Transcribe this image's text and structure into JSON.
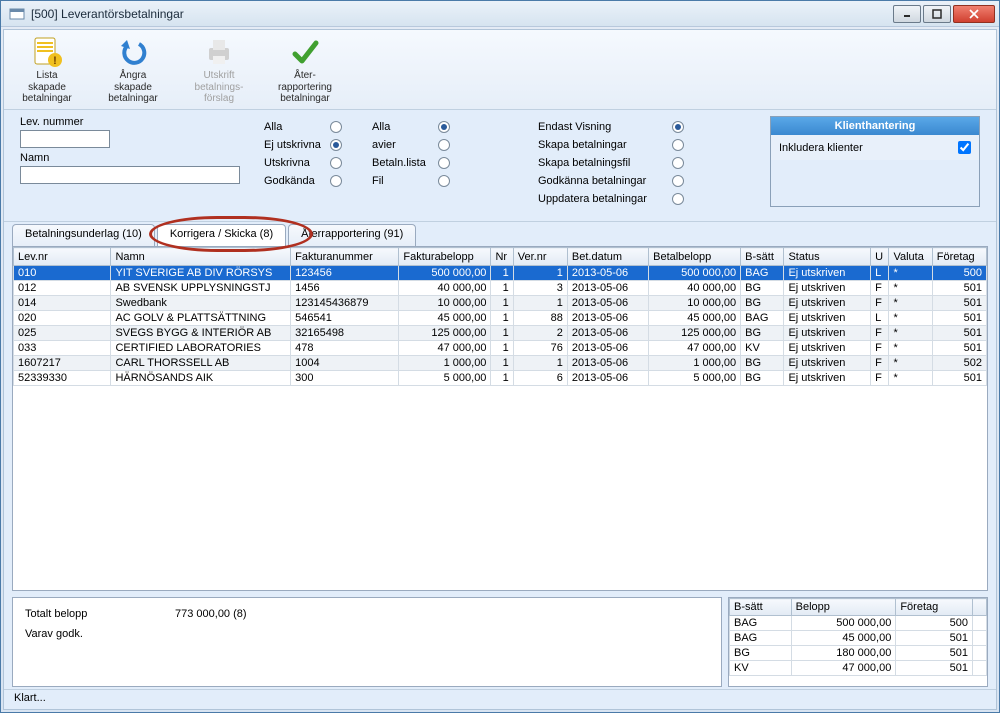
{
  "window": {
    "title": "[500]  Leverantörsbetalningar"
  },
  "toolbar": [
    {
      "name": "lista-skapade",
      "label": "Lista\nskapade\nbetalningar",
      "enabled": true,
      "color": "#f0c020"
    },
    {
      "name": "angra-skapade",
      "label": "Ångra\nskapade\nbetalningar",
      "enabled": true,
      "color": "#3080d0"
    },
    {
      "name": "utskrift",
      "label": "Utskrift\nbetalnings-\nförslag",
      "enabled": false,
      "color": "#c0c0c0"
    },
    {
      "name": "aterrapp",
      "label": "Åter-\nrapportering\nbetalningar",
      "enabled": true,
      "color": "#40a030"
    }
  ],
  "filters": {
    "levnummer_label": "Lev. nummer",
    "levnummer_value": "",
    "namn_label": "Namn",
    "namn_value": "",
    "col1": [
      {
        "label": "Alla",
        "selected": false
      },
      {
        "label": "Ej utskrivna",
        "selected": true
      },
      {
        "label": "Utskrivna",
        "selected": false
      },
      {
        "label": "Godkända",
        "selected": false
      }
    ],
    "col2": [
      {
        "label": "Alla",
        "selected": true
      },
      {
        "label": "avier",
        "selected": false
      },
      {
        "label": "Betaln.lista",
        "selected": false
      },
      {
        "label": "Fil",
        "selected": false
      }
    ],
    "opts": [
      {
        "label": "Endast Visning",
        "selected": true
      },
      {
        "label": "Skapa betalningar",
        "selected": false
      },
      {
        "label": "Skapa betalningsfil",
        "selected": false
      },
      {
        "label": "Godkänna betalningar",
        "selected": false
      },
      {
        "label": "Uppdatera betalningar",
        "selected": false
      }
    ]
  },
  "klient": {
    "header": "Klienthantering",
    "label": "Inkludera klienter",
    "checked": true
  },
  "tabs": [
    {
      "name": "betalningsunderlag",
      "label": "Betalningsunderlag (10)",
      "active": false
    },
    {
      "name": "korrigera-skicka",
      "label": "Korrigera / Skicka (8)",
      "active": true
    },
    {
      "name": "aterrapportering",
      "label": "Återrapportering (91)",
      "active": false
    }
  ],
  "grid": {
    "headers": [
      "Lev.nr",
      "Namn",
      "Fakturanummer",
      "Fakturabelopp",
      "Nr",
      "Ver.nr",
      "Bet.datum",
      "Betalbelopp",
      "B-sätt",
      "Status",
      "U",
      "Valuta",
      "Företag"
    ],
    "rows": [
      {
        "sel": true,
        "alt": false,
        "cells": [
          "010",
          "YIT SVERIGE AB DIV RÖRSYS",
          "123456",
          "500 000,00",
          "1",
          "1",
          "2013-05-06",
          "500 000,00",
          "BAG",
          "Ej utskriven",
          "L",
          "*",
          "500"
        ]
      },
      {
        "sel": false,
        "alt": false,
        "cells": [
          "012",
          "AB SVENSK UPPLYSNINGSTJ",
          "1456",
          "40 000,00",
          "1",
          "3",
          "2013-05-06",
          "40 000,00",
          "BG",
          "Ej utskriven",
          "F",
          "*",
          "501"
        ]
      },
      {
        "sel": false,
        "alt": true,
        "cells": [
          "014",
          "Swedbank",
          "123145436879",
          "10 000,00",
          "1",
          "1",
          "2013-05-06",
          "10 000,00",
          "BG",
          "Ej utskriven",
          "F",
          "*",
          "501"
        ]
      },
      {
        "sel": false,
        "alt": false,
        "cells": [
          "020",
          "AC GOLV & PLATTSÄTTNING",
          "546541",
          "45 000,00",
          "1",
          "88",
          "2013-05-06",
          "45 000,00",
          "BAG",
          "Ej utskriven",
          "L",
          "*",
          "501"
        ]
      },
      {
        "sel": false,
        "alt": true,
        "cells": [
          "025",
          "SVEGS BYGG & INTERIÖR AB",
          "32165498",
          "125 000,00",
          "1",
          "2",
          "2013-05-06",
          "125 000,00",
          "BG",
          "Ej utskriven",
          "F",
          "*",
          "501"
        ]
      },
      {
        "sel": false,
        "alt": false,
        "cells": [
          "033",
          "CERTIFIED LABORATORIES",
          "478",
          "47 000,00",
          "1",
          "76",
          "2013-05-06",
          "47 000,00",
          "KV",
          "Ej utskriven",
          "F",
          "*",
          "501"
        ]
      },
      {
        "sel": false,
        "alt": true,
        "cells": [
          "1607217",
          "CARL THORSSELL AB",
          "1004",
          "1 000,00",
          "1",
          "1",
          "2013-05-06",
          "1 000,00",
          "BG",
          "Ej utskriven",
          "F",
          "*",
          "502"
        ]
      },
      {
        "sel": false,
        "alt": false,
        "cells": [
          "52339330",
          "HÄRNÖSANDS AIK",
          "300",
          "5 000,00",
          "1",
          "6",
          "2013-05-06",
          "5 000,00",
          "BG",
          "Ej utskriven",
          "F",
          "*",
          "501"
        ]
      }
    ]
  },
  "summary": {
    "total_label": "Totalt belopp",
    "total_value": "773 000,00 (8)",
    "godk_label": "Varav godk."
  },
  "mini": {
    "headers": [
      "B-sätt",
      "Belopp",
      "Företag"
    ],
    "rows": [
      [
        "BAG",
        "500 000,00",
        "500"
      ],
      [
        "BAG",
        "45 000,00",
        "501"
      ],
      [
        "BG",
        "180 000,00",
        "501"
      ],
      [
        "KV",
        "47 000,00",
        "501"
      ]
    ]
  },
  "status": "Klart..."
}
